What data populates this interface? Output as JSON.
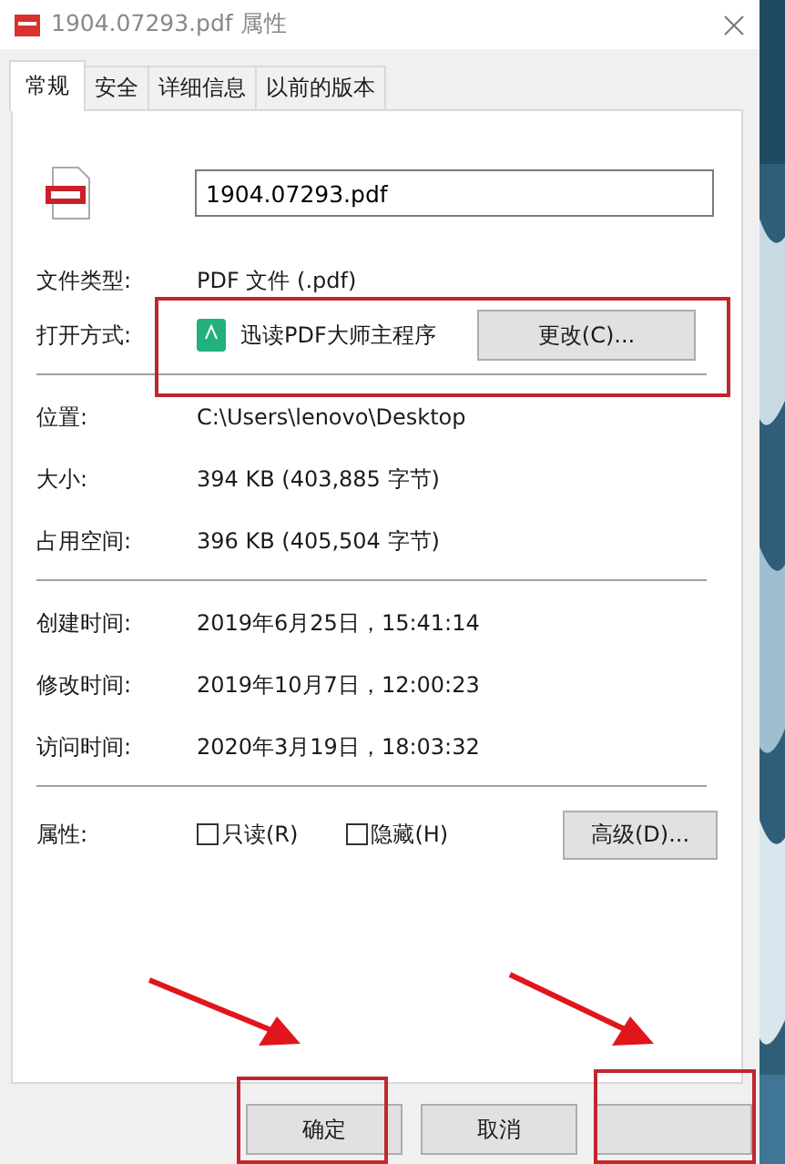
{
  "window": {
    "title": "1904.07293.pdf 属性"
  },
  "tabs": [
    {
      "label": "常规",
      "selected": true
    },
    {
      "label": "安全",
      "selected": false
    },
    {
      "label": "详细信息",
      "selected": false
    },
    {
      "label": "以前的版本",
      "selected": false
    }
  ],
  "file_name": {
    "value": "1904.07293.pdf"
  },
  "file_type": {
    "label": "文件类型:",
    "value": "PDF 文件 (.pdf)"
  },
  "open_with": {
    "label": "打开方式:",
    "app": "迅读PDF大师主程序",
    "button": "更改(C)..."
  },
  "location_rows": [
    {
      "label": "位置:",
      "value": "C:\\Users\\lenovo\\Desktop"
    },
    {
      "label": "大小:",
      "value": "394 KB (403,885 字节)"
    },
    {
      "label": "占用空间:",
      "value": "396 KB (405,504 字节)"
    }
  ],
  "time_rows": [
    {
      "label": "创建时间:",
      "value": "2019年6月25日，15:41:14"
    },
    {
      "label": "修改时间:",
      "value": "2019年10月7日，12:00:23"
    },
    {
      "label": "访问时间:",
      "value": "2020年3月19日，18:03:32"
    }
  ],
  "attributes": {
    "label": "属性:",
    "checkboxes": [
      {
        "label": "只读(R)",
        "checked": false
      },
      {
        "label": "隐藏(H)",
        "checked": false
      }
    ],
    "button": "高级(D)..."
  },
  "footer_buttons": [
    {
      "label": "确定"
    },
    {
      "label": "取消"
    }
  ]
}
